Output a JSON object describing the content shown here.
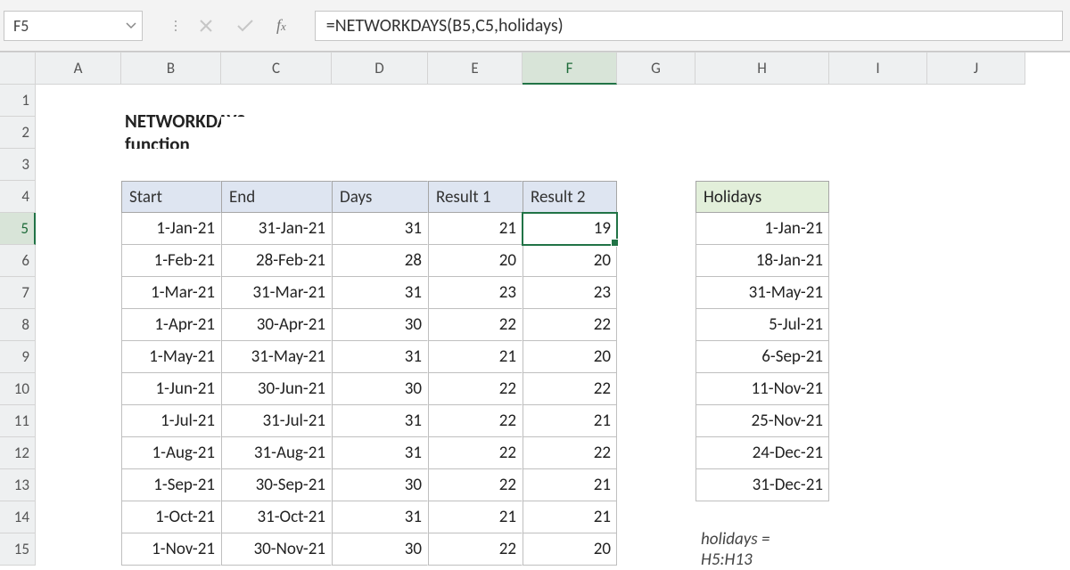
{
  "namebox": "F5",
  "formula": "=NETWORKDAYS(B5,C5,holidays)",
  "columns": [
    "A",
    "B",
    "C",
    "D",
    "E",
    "F",
    "G",
    "H",
    "I",
    "J"
  ],
  "rows": [
    "1",
    "2",
    "3",
    "4",
    "5",
    "6",
    "7",
    "8",
    "9",
    "10",
    "11",
    "12",
    "13",
    "14",
    "15"
  ],
  "active_col": "F",
  "active_row": "5",
  "title": "NETWORKDAYS function",
  "headers": {
    "start": "Start",
    "end": "End",
    "days": "Days",
    "result1": "Result 1",
    "result2": "Result 2",
    "holidays": "Holidays"
  },
  "table": [
    {
      "start": "1-Jan-21",
      "end": "31-Jan-21",
      "days": "31",
      "r1": "21",
      "r2": "19"
    },
    {
      "start": "1-Feb-21",
      "end": "28-Feb-21",
      "days": "28",
      "r1": "20",
      "r2": "20"
    },
    {
      "start": "1-Mar-21",
      "end": "31-Mar-21",
      "days": "31",
      "r1": "23",
      "r2": "23"
    },
    {
      "start": "1-Apr-21",
      "end": "30-Apr-21",
      "days": "30",
      "r1": "22",
      "r2": "22"
    },
    {
      "start": "1-May-21",
      "end": "31-May-21",
      "days": "31",
      "r1": "21",
      "r2": "20"
    },
    {
      "start": "1-Jun-21",
      "end": "30-Jun-21",
      "days": "30",
      "r1": "22",
      "r2": "22"
    },
    {
      "start": "1-Jul-21",
      "end": "31-Jul-21",
      "days": "31",
      "r1": "22",
      "r2": "21"
    },
    {
      "start": "1-Aug-21",
      "end": "31-Aug-21",
      "days": "31",
      "r1": "22",
      "r2": "22"
    },
    {
      "start": "1-Sep-21",
      "end": "30-Sep-21",
      "days": "30",
      "r1": "22",
      "r2": "21"
    },
    {
      "start": "1-Oct-21",
      "end": "31-Oct-21",
      "days": "31",
      "r1": "21",
      "r2": "21"
    },
    {
      "start": "1-Nov-21",
      "end": "30-Nov-21",
      "days": "30",
      "r1": "22",
      "r2": "20"
    }
  ],
  "holidays_list": [
    "1-Jan-21",
    "18-Jan-21",
    "31-May-21",
    "5-Jul-21",
    "6-Sep-21",
    "11-Nov-21",
    "25-Nov-21",
    "24-Dec-21",
    "31-Dec-21"
  ],
  "note": "holidays = H5:H13"
}
